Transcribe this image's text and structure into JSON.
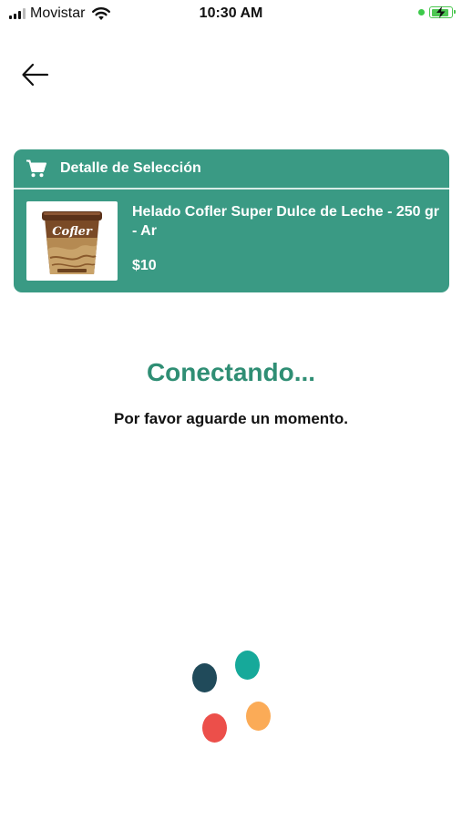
{
  "status_bar": {
    "carrier": "Movistar",
    "time": "10:30 AM",
    "signal_icon": "cellular-signal-icon",
    "wifi_icon": "wifi-icon",
    "battery_icon": "battery-charging-icon"
  },
  "nav": {
    "back_icon": "arrow-left-icon"
  },
  "selection": {
    "header_icon": "shopping-cart-icon",
    "title": "Detalle de Selección",
    "product": {
      "name": "Helado Cofler Super Dulce de Leche - 250 gr - Ar",
      "price": "$10",
      "image_brand": "Cofler"
    }
  },
  "status": {
    "title": "Conectando...",
    "subtitle": "Por favor aguarde un momento."
  },
  "loader": {
    "dot_colors": [
      "#204a5a",
      "#16a99a",
      "#ec4f4a",
      "#fbab57"
    ]
  },
  "colors": {
    "card_bg": "#3a9a84",
    "accent_text": "#2f8e74"
  }
}
